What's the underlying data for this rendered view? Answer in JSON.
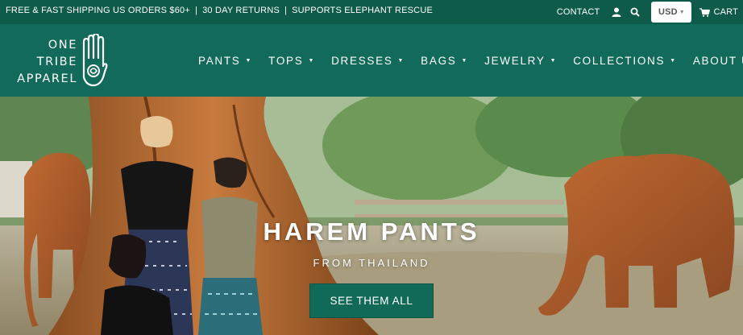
{
  "topbar": {
    "promo": [
      "FREE & FAST SHIPPING US ORDERS $60+",
      "30 DAY RETURNS",
      "SUPPORTS ELEPHANT RESCUE"
    ],
    "separator": "|",
    "contact": "CONTACT",
    "account_icon": "user-icon",
    "search_icon": "search-icon",
    "currency": "USD",
    "cart": "CART",
    "cart_icon": "cart-icon"
  },
  "logo": {
    "line1": "ONE",
    "line2": "TRIBE",
    "line3": "APPAREL",
    "icon": "hamsa-hand-icon"
  },
  "nav": {
    "items": [
      {
        "label": "PANTS"
      },
      {
        "label": "TOPS"
      },
      {
        "label": "DRESSES"
      },
      {
        "label": "BAGS"
      },
      {
        "label": "JEWELRY"
      },
      {
        "label": "COLLECTIONS"
      },
      {
        "label": "ABOUT US"
      }
    ],
    "caret": "▼"
  },
  "hero": {
    "title": "HAREM PANTS",
    "subtitle": "FROM THAILAND",
    "button": "SEE THEM ALL"
  },
  "colors": {
    "brand_green": "#116a58",
    "topbar_green": "#0f5b49",
    "button_green": "#116a58"
  }
}
